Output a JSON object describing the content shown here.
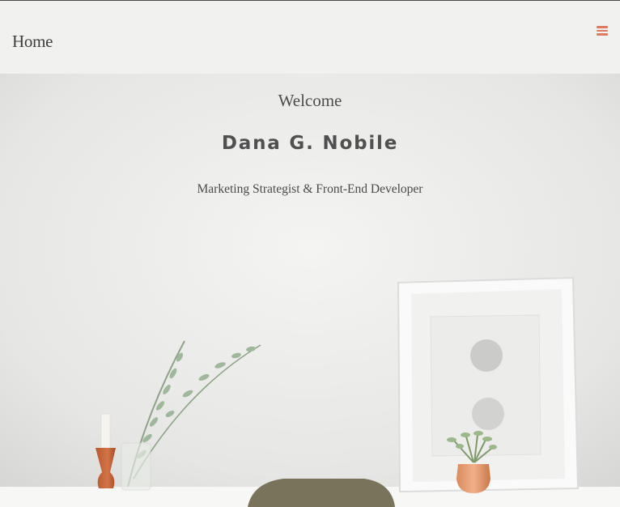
{
  "nav": {
    "brand": "Home",
    "menu_icon": "hamburger-icon",
    "accent_color": "#e07a5f"
  },
  "hero": {
    "welcome": "Welcome",
    "name": "Dana G. Nobile",
    "tagline": "Marketing Strategist & Front-End Developer"
  }
}
